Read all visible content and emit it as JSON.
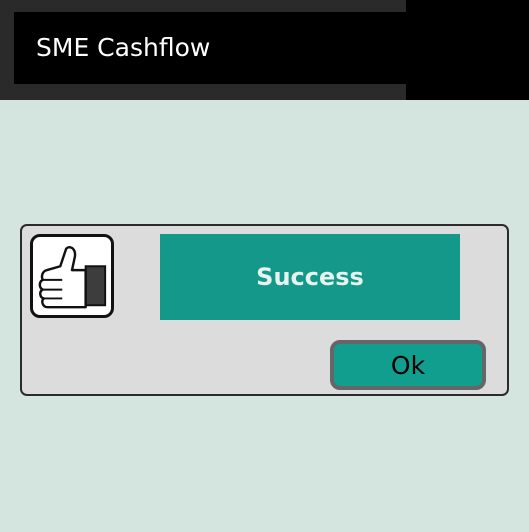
{
  "app": {
    "title": "SME Cashflow"
  },
  "dialog": {
    "icon": "thumbs-up-icon",
    "message": "Success",
    "ok_label": "Ok"
  },
  "colors": {
    "background": "#d4e4df",
    "title_bar": "#000000",
    "accent": "#139889",
    "dialog_bg": "#dcdcdc"
  }
}
